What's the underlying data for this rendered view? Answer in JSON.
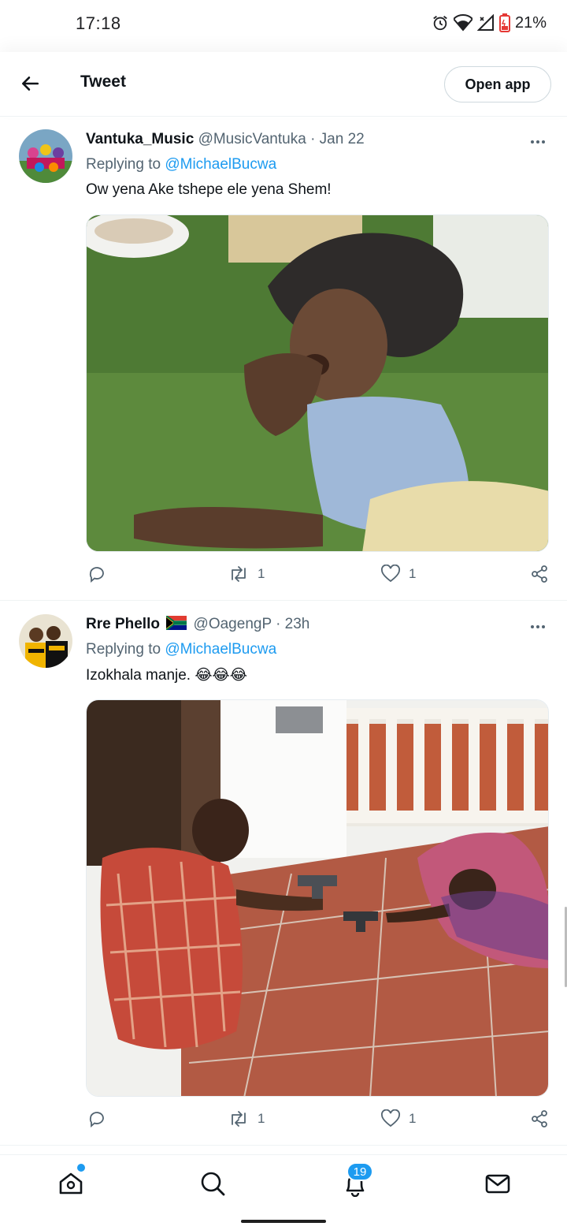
{
  "status_bar": {
    "time": "17:18",
    "battery": "21%"
  },
  "header": {
    "title": "Tweet",
    "open_app_label": "Open app"
  },
  "tweets": [
    {
      "name": "Vantuka_Music",
      "handle": "@MusicVantuka",
      "time": "· Jan 22",
      "replying_prefix": "Replying to",
      "replying_to": "@MichaelBucwa",
      "text": "Ow yena Ake tshepe ele yena Shem!",
      "retweets": "1",
      "likes": "1"
    },
    {
      "name": "Rre Phello",
      "handle": "@OagengP",
      "time": "· 23h",
      "replying_prefix": "Replying to",
      "replying_to": "@MichaelBucwa",
      "text": "Izokhala manje. 😂😂😂",
      "retweets": "1",
      "likes": "1"
    }
  ],
  "bottom_nav": {
    "notifications_count": "19"
  },
  "icons": [
    "back-arrow-icon",
    "more-icon",
    "reply-icon",
    "retweet-icon",
    "like-icon",
    "share-icon",
    "home-icon",
    "search-icon",
    "notifications-icon",
    "messages-icon"
  ],
  "colors": {
    "accent": "#1d9bf0",
    "secondary_text": "#536471",
    "text": "#0f1419"
  }
}
